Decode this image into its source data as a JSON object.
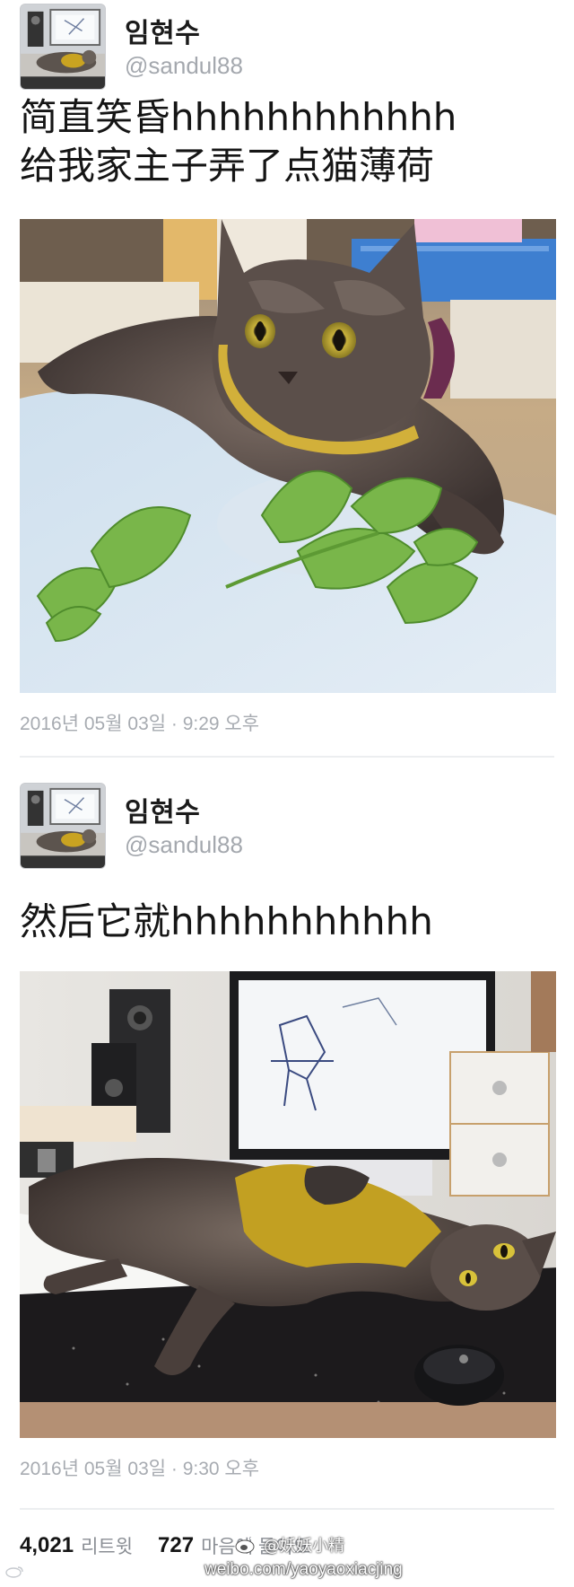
{
  "tweets": [
    {
      "user": {
        "name": "임현수",
        "handle": "@sandul88"
      },
      "text_lines": [
        "简直笑昏hhhhhhhhhhhh",
        "给我家主子弄了点猫薄荷"
      ],
      "timestamp": "2016년 05월 03일 · 9:29 오후"
    },
    {
      "user": {
        "name": "임현수",
        "handle": "@sandul88"
      },
      "text_lines": [
        "然后它就hhhhhhhhhhh"
      ],
      "timestamp": "2016년 05월 03일 · 9:30 오후"
    }
  ],
  "stats": {
    "retweets_count": "4,021",
    "retweets_label": "리트윗",
    "likes_count": "727",
    "likes_label": "마음에 들어요"
  },
  "watermarks": {
    "weibo_name": "@妖妖小精",
    "weibo_url": "weibo.com/yaoyaoxiacjing"
  },
  "colors": {
    "handle": "#a4a8ae",
    "timestamp": "#a7abb1",
    "divider": "#eceef0",
    "text": "#151515"
  }
}
